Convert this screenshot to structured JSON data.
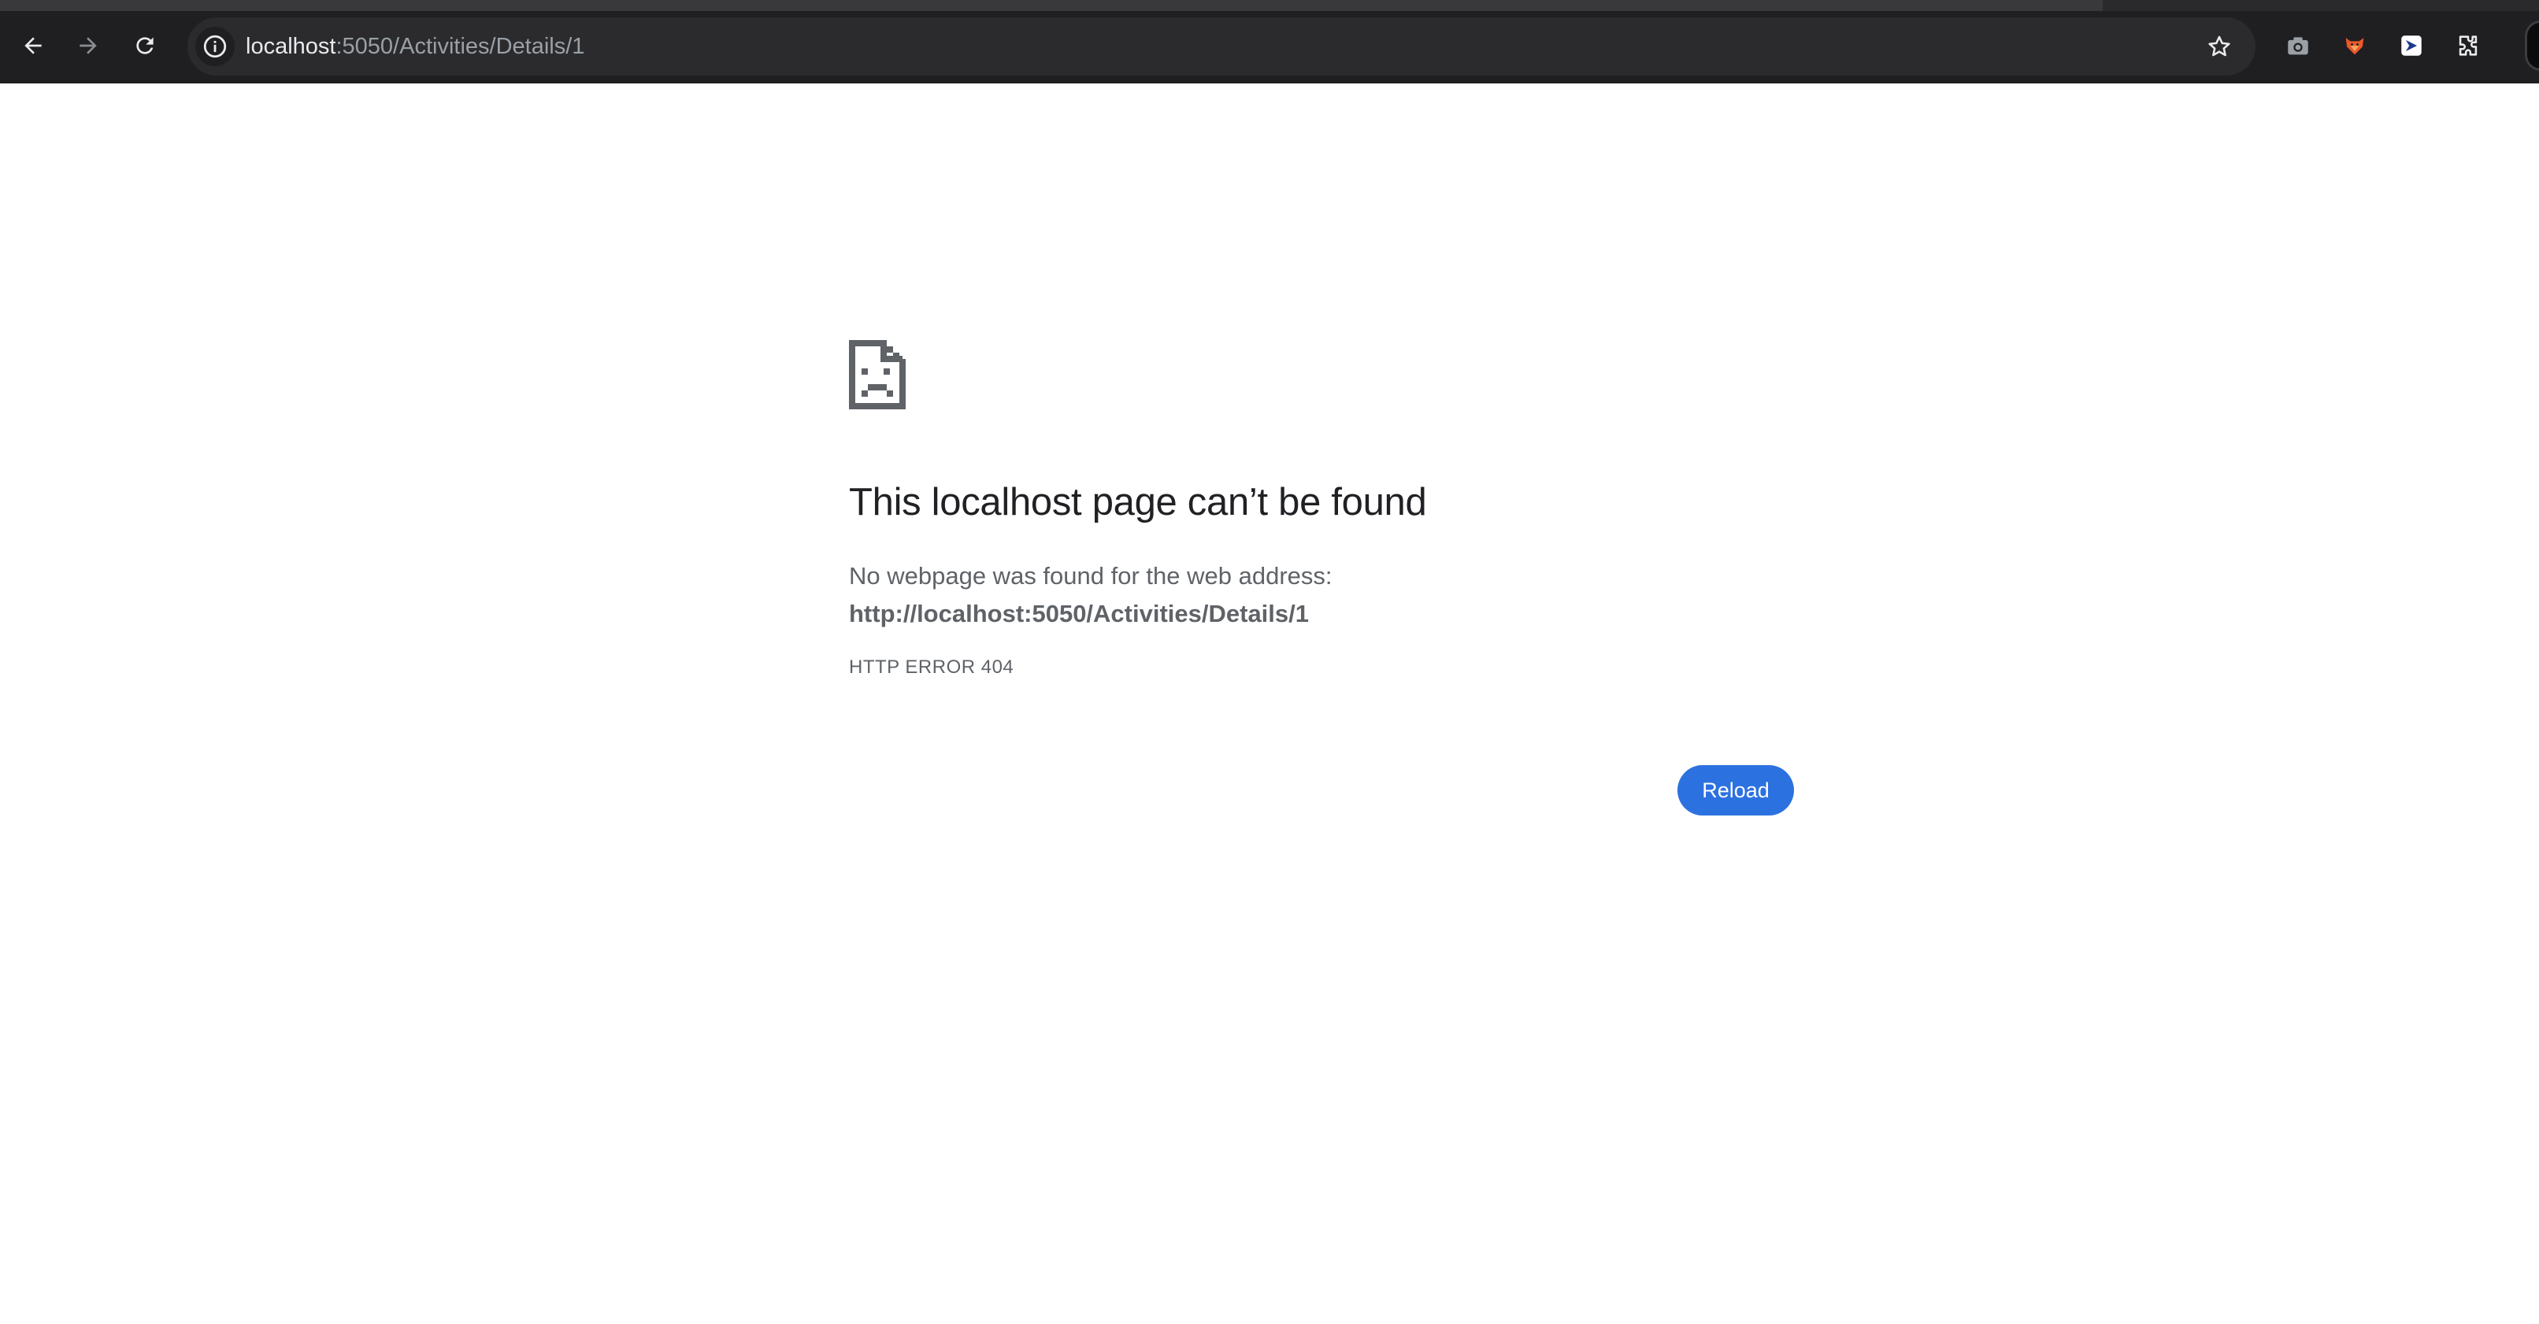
{
  "browser": {
    "nav": {
      "back_icon": "arrow-left-icon",
      "forward_icon": "arrow-right-icon",
      "reload_icon": "reload-icon"
    },
    "omnibox": {
      "site_info_icon": "info-circle-icon",
      "url_host": "localhost",
      "url_rest": ":5050/Activities/Details/1",
      "bookmark_icon": "star-outline-icon"
    },
    "extensions": [
      {
        "name": "camera-extension-icon",
        "color": "#9aa0a6"
      },
      {
        "name": "fox-extension-icon",
        "color": "#e8582a"
      },
      {
        "name": "shield-extension-icon",
        "color": "#ffffff"
      },
      {
        "name": "puzzle-extensions-icon",
        "color": "#e8eaed"
      }
    ],
    "colors": {
      "toolbar": "#1f1f21",
      "omnibox": "#2b2b2e",
      "url_host": "#e8eaed",
      "url_path": "#9aa0a6"
    }
  },
  "error_page": {
    "icon": "sad-page-icon",
    "title": "This localhost page can’t be found",
    "description": "No webpage was found for the web address:",
    "url": "http://localhost:5050/Activities/Details/1",
    "error_code": "HTTP ERROR 404",
    "reload_label": "Reload",
    "colors": {
      "title": "#202124",
      "body": "#5f6368",
      "button": "#2c71e0"
    }
  }
}
